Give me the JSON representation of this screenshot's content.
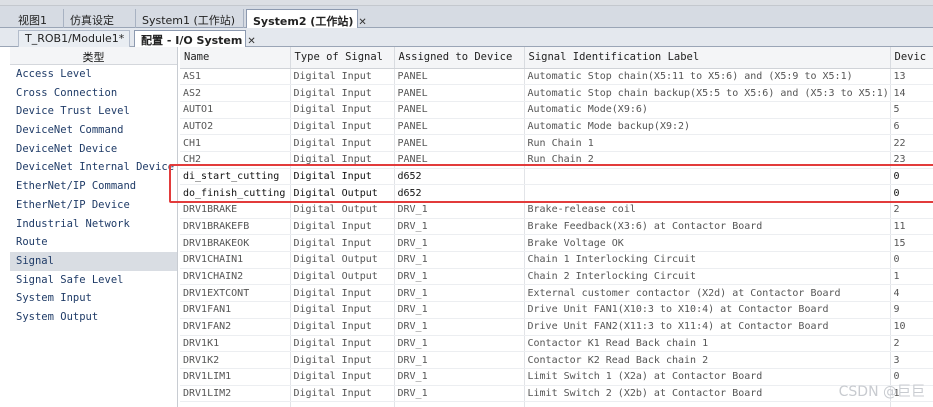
{
  "window_tabs": [
    {
      "label": "视图1",
      "active": false
    },
    {
      "label": "仿真设定",
      "active": false
    },
    {
      "label": "System1 (工作站)",
      "active": false
    },
    {
      "label": "System2 (工作站)",
      "active": true
    }
  ],
  "close_glyph": "✕",
  "doc_tabs": [
    {
      "label": "T_ROB1/Module1*",
      "active": false
    },
    {
      "label": "配置 - I/O System",
      "active": true
    }
  ],
  "types_panel": {
    "header": "类型",
    "items": [
      "Access Level",
      "Cross Connection",
      "Device Trust Level",
      "DeviceNet Command",
      "DeviceNet Device",
      "DeviceNet Internal Device",
      "EtherNet/IP Command",
      "EtherNet/IP Device",
      "Industrial Network",
      "Route",
      "Signal",
      "Signal Safe Level",
      "System Input",
      "System Output"
    ],
    "selected": "Signal"
  },
  "grid": {
    "columns": [
      "Name",
      "Type of Signal",
      "Assigned to Device",
      "Signal Identification Label",
      "Devic"
    ],
    "rows": [
      {
        "name": "AS1",
        "type": "Digital Input",
        "device": "PANEL",
        "label": "Automatic Stop chain(X5:11 to X5:6) and (X5:9 to X5:1)",
        "mapping": "13"
      },
      {
        "name": "AS2",
        "type": "Digital Input",
        "device": "PANEL",
        "label": "Automatic Stop chain backup(X5:5 to X5:6) and (X5:3 to X5:1)",
        "mapping": "14"
      },
      {
        "name": "AUTO1",
        "type": "Digital Input",
        "device": "PANEL",
        "label": "Automatic Mode(X9:6)",
        "mapping": "5"
      },
      {
        "name": "AUTO2",
        "type": "Digital Input",
        "device": "PANEL",
        "label": "Automatic Mode backup(X9:2)",
        "mapping": "6"
      },
      {
        "name": "CH1",
        "type": "Digital Input",
        "device": "PANEL",
        "label": "Run Chain 1",
        "mapping": "22"
      },
      {
        "name": "CH2",
        "type": "Digital Input",
        "device": "PANEL",
        "label": "Run Chain 2",
        "mapping": "23"
      },
      {
        "name": "di_start_cutting",
        "type": "Digital Input",
        "device": "d652",
        "label": "",
        "mapping": "0"
      },
      {
        "name": "do_finish_cutting",
        "type": "Digital Output",
        "device": "d652",
        "label": "",
        "mapping": "0"
      },
      {
        "name": "DRV1BRAKE",
        "type": "Digital Output",
        "device": "DRV_1",
        "label": "Brake-release coil",
        "mapping": "2"
      },
      {
        "name": "DRV1BRAKEFB",
        "type": "Digital Input",
        "device": "DRV_1",
        "label": "Brake Feedback(X3:6) at Contactor Board",
        "mapping": "11"
      },
      {
        "name": "DRV1BRAKEOK",
        "type": "Digital Input",
        "device": "DRV_1",
        "label": "Brake Voltage OK",
        "mapping": "15"
      },
      {
        "name": "DRV1CHAIN1",
        "type": "Digital Output",
        "device": "DRV_1",
        "label": "Chain 1 Interlocking Circuit",
        "mapping": "0"
      },
      {
        "name": "DRV1CHAIN2",
        "type": "Digital Output",
        "device": "DRV_1",
        "label": "Chain 2 Interlocking Circuit",
        "mapping": "1"
      },
      {
        "name": "DRV1EXTCONT",
        "type": "Digital Input",
        "device": "DRV_1",
        "label": "External customer contactor (X2d) at Contactor Board",
        "mapping": "4"
      },
      {
        "name": "DRV1FAN1",
        "type": "Digital Input",
        "device": "DRV_1",
        "label": "Drive Unit FAN1(X10:3 to X10:4) at Contactor Board",
        "mapping": "9"
      },
      {
        "name": "DRV1FAN2",
        "type": "Digital Input",
        "device": "DRV_1",
        "label": "Drive Unit FAN2(X11:3 to X11:4) at Contactor Board",
        "mapping": "10"
      },
      {
        "name": "DRV1K1",
        "type": "Digital Input",
        "device": "DRV_1",
        "label": "Contactor K1 Read Back chain 1",
        "mapping": "2"
      },
      {
        "name": "DRV1K2",
        "type": "Digital Input",
        "device": "DRV_1",
        "label": "Contactor K2 Read Back chain 2",
        "mapping": "3"
      },
      {
        "name": "DRV1LIM1",
        "type": "Digital Input",
        "device": "DRV_1",
        "label": "Limit Switch 1 (X2a) at Contactor Board",
        "mapping": "0"
      },
      {
        "name": "DRV1LIM2",
        "type": "Digital Input",
        "device": "DRV_1",
        "label": "Limit Switch 2 (X2b) at Contactor Board",
        "mapping": "1"
      },
      {
        "name": "",
        "type": "",
        "device": "",
        "label": "",
        "mapping": ""
      }
    ],
    "user_rows": [
      "di_start_cutting",
      "do_finish_cutting"
    ]
  },
  "watermark": "CSDN @巨巨",
  "colors": {
    "highlight": "#e23b3b",
    "selection": "#d9dde3",
    "type_text": "#1f3b67"
  }
}
